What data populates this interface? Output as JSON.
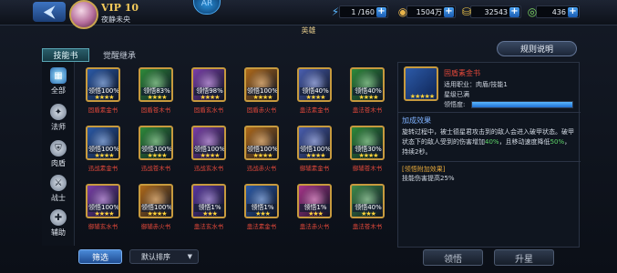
{
  "topbar": {
    "back_label": "⮜",
    "vip": "VIP 10",
    "username": "夜静未央",
    "emblem": "AR",
    "resources": [
      {
        "icon": "stamina-icon",
        "glyph": "⚡",
        "value": "1 /160"
      },
      {
        "icon": "gold-coin-icon",
        "glyph": "◉",
        "value": "1504万"
      },
      {
        "icon": "ingot-icon",
        "glyph": "⛁",
        "value": "32543"
      },
      {
        "icon": "jade-icon",
        "glyph": "◎",
        "value": "436"
      }
    ]
  },
  "section_title": "英雄",
  "tabs": [
    {
      "label": "技能书"
    },
    {
      "label": "觉醒继承"
    }
  ],
  "rules_button": "规则说明",
  "categories": [
    {
      "label": "全部",
      "icon": "grid-icon",
      "glyph": "▦"
    },
    {
      "label": "法师",
      "icon": "mage-icon",
      "glyph": "✦"
    },
    {
      "label": "肉盾",
      "icon": "shield-icon",
      "glyph": "⛨"
    },
    {
      "label": "战士",
      "icon": "sword-icon",
      "glyph": "⚔"
    },
    {
      "label": "辅助",
      "icon": "support-icon",
      "glyph": "✚"
    }
  ],
  "books": [
    {
      "name": "固盾素金书",
      "pct": "领悟100%",
      "stars": "★★★★",
      "color": "#2b5aa8"
    },
    {
      "name": "固盾苍木书",
      "pct": "领悟83%",
      "stars": "★★★★",
      "color": "#2f8a3a"
    },
    {
      "name": "固盾玄水书",
      "pct": "领悟98%",
      "stars": "★★★★",
      "color": "#7a3fa8"
    },
    {
      "name": "固盾赤火书",
      "pct": "领悟100%",
      "stars": "★★★★",
      "color": "#b06a1a"
    },
    {
      "name": "蛊法素金书",
      "pct": "领悟40%",
      "stars": "★★★★",
      "color": "#4a5fb0"
    },
    {
      "name": "蛊法苍木书",
      "pct": "领悟40%",
      "stars": "★★★★",
      "color": "#2f8a3a"
    },
    {
      "name": "迅战素金书",
      "pct": "领悟100%",
      "stars": "★★★★",
      "color": "#2b5aa8"
    },
    {
      "name": "迅战苍木书",
      "pct": "领悟100%",
      "stars": "★★★★",
      "color": "#2f8a3a"
    },
    {
      "name": "迅战玄水书",
      "pct": "领悟100%",
      "stars": "★★★★",
      "color": "#7a3fa8"
    },
    {
      "name": "迅战赤火书",
      "pct": "领悟100%",
      "stars": "★★★★",
      "color": "#b06a1a"
    },
    {
      "name": "御辅素金书",
      "pct": "领悟100%",
      "stars": "★★★★",
      "color": "#4a5fb0"
    },
    {
      "name": "御辅苍木书",
      "pct": "领悟30%",
      "stars": "★★★★",
      "color": "#2f8a3a"
    },
    {
      "name": "御辅玄水书",
      "pct": "领悟100%",
      "stars": "★★★★",
      "color": "#7a3fa8"
    },
    {
      "name": "御辅赤火书",
      "pct": "领悟100%",
      "stars": "★★★★",
      "color": "#b06a1a"
    },
    {
      "name": "蛊法玄水书",
      "pct": "领悟1%",
      "stars": "★★★",
      "color": "#5a38a0"
    },
    {
      "name": "蛊法素金书",
      "pct": "领悟1%",
      "stars": "★★★",
      "color": "#2b5aa8"
    },
    {
      "name": "蛊法赤火书",
      "pct": "领悟1%",
      "stars": "★★★",
      "color": "#a8348a"
    },
    {
      "name": "蛊法苍木书",
      "pct": "领悟40%",
      "stars": "★★★",
      "color": "#3e8a4a"
    }
  ],
  "detail": {
    "name": "固盾素金书",
    "stars": "★★★★★",
    "job": "适用职业：肉盾/技能1",
    "level": "星级已满",
    "progress_label": "领悟度:",
    "progress": 1.0,
    "effect_title": "加成效果",
    "effect_1": "旋转过程中，被士德星君攻击到的敌人会进入破甲状态。破甲状态下的敌人受到的伤害增加",
    "effect_hl1": "40%",
    "effect_2": "，且移动速度降低",
    "effect_hl2": "50%",
    "effect_3": "，持续2秒。",
    "extra_title": "[领悟附加效果]",
    "extra_text": "技能伤害提高25%"
  },
  "bottom": {
    "filter": "筛选",
    "sort": "默认排序",
    "comprehend": "领悟",
    "upgrade": "升星"
  }
}
